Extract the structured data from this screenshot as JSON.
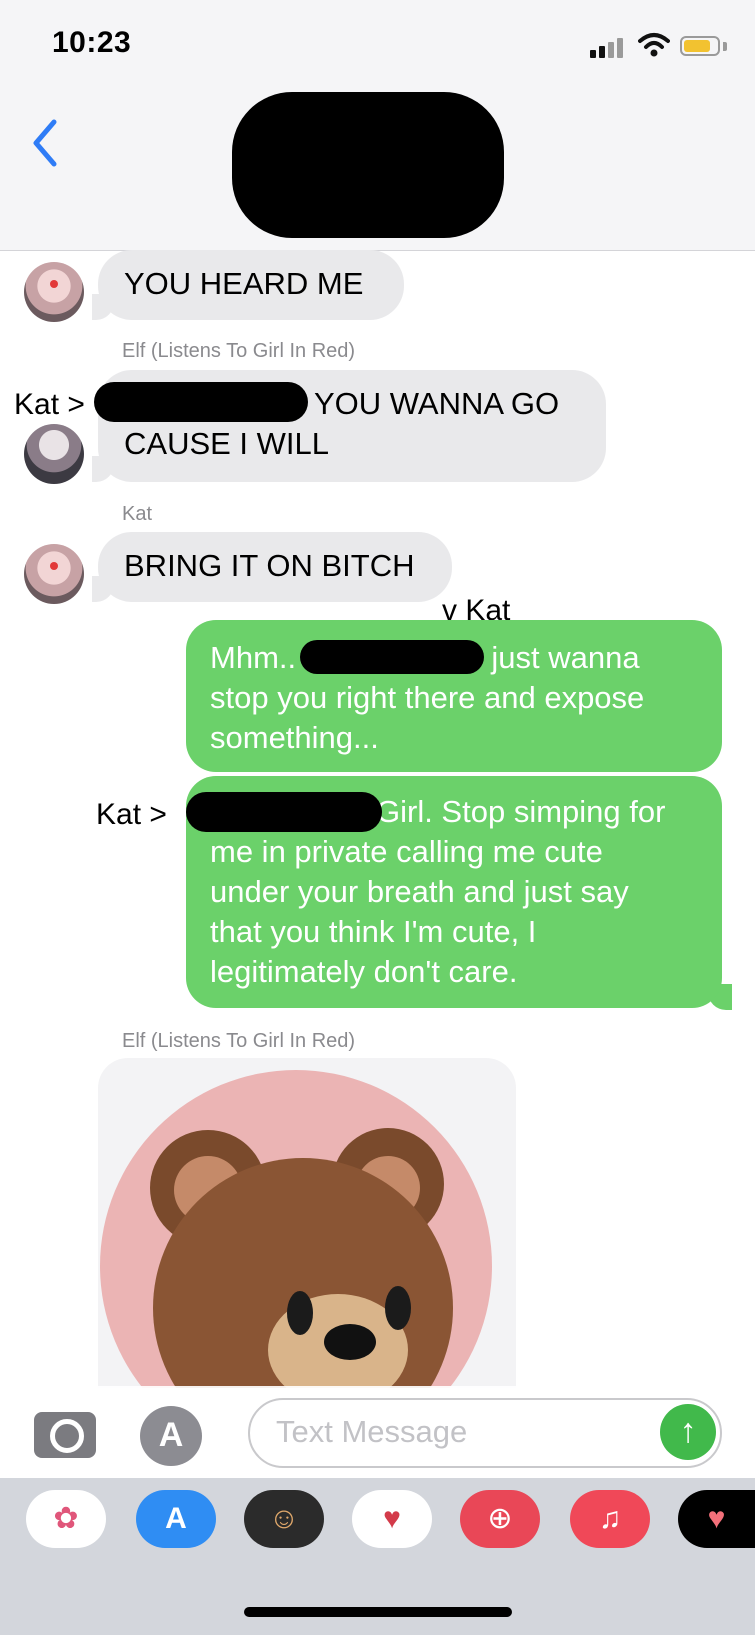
{
  "status_bar": {
    "time": "10:23"
  },
  "messages": [
    {
      "sender": "",
      "text": "YOU HEARD ME"
    },
    {
      "sender": "Elf (Listens To Girl In Red)",
      "text": "YOU WANNA GO",
      "text_line2": "CAUSE I WILL"
    },
    {
      "sender": "Kat",
      "text": "BRING IT ON BITCH"
    },
    {
      "text_before": "Mhm..",
      "text_after": "I just wanna",
      "text_line2": "stop you right there and expose",
      "text_line3": "something..."
    },
    {
      "text_after": "Girl. Stop simping for",
      "text_line2": "me in private calling me cute",
      "text_line3": "under your breath and just say",
      "text_line4": "that you think I'm cute, I",
      "text_line5": "legitimately don't care."
    },
    {
      "sender": "Elf (Listens To Girl In Red)"
    }
  ],
  "annotations": {
    "kat_1": "Kat >",
    "kat_2": "v Kat",
    "kat_3": "Kat >"
  },
  "composer": {
    "placeholder": "Text Message"
  },
  "app_drawer": [
    "photos-icon",
    "app-store-icon",
    "memoji-stickers-icon",
    "animoji-icon",
    "web-search-icon",
    "music-icon",
    "heart-app-icon"
  ],
  "colors": {
    "outgoing": "#6bd16a",
    "incoming": "#e9e9eb",
    "accent": "#1a73e8"
  }
}
